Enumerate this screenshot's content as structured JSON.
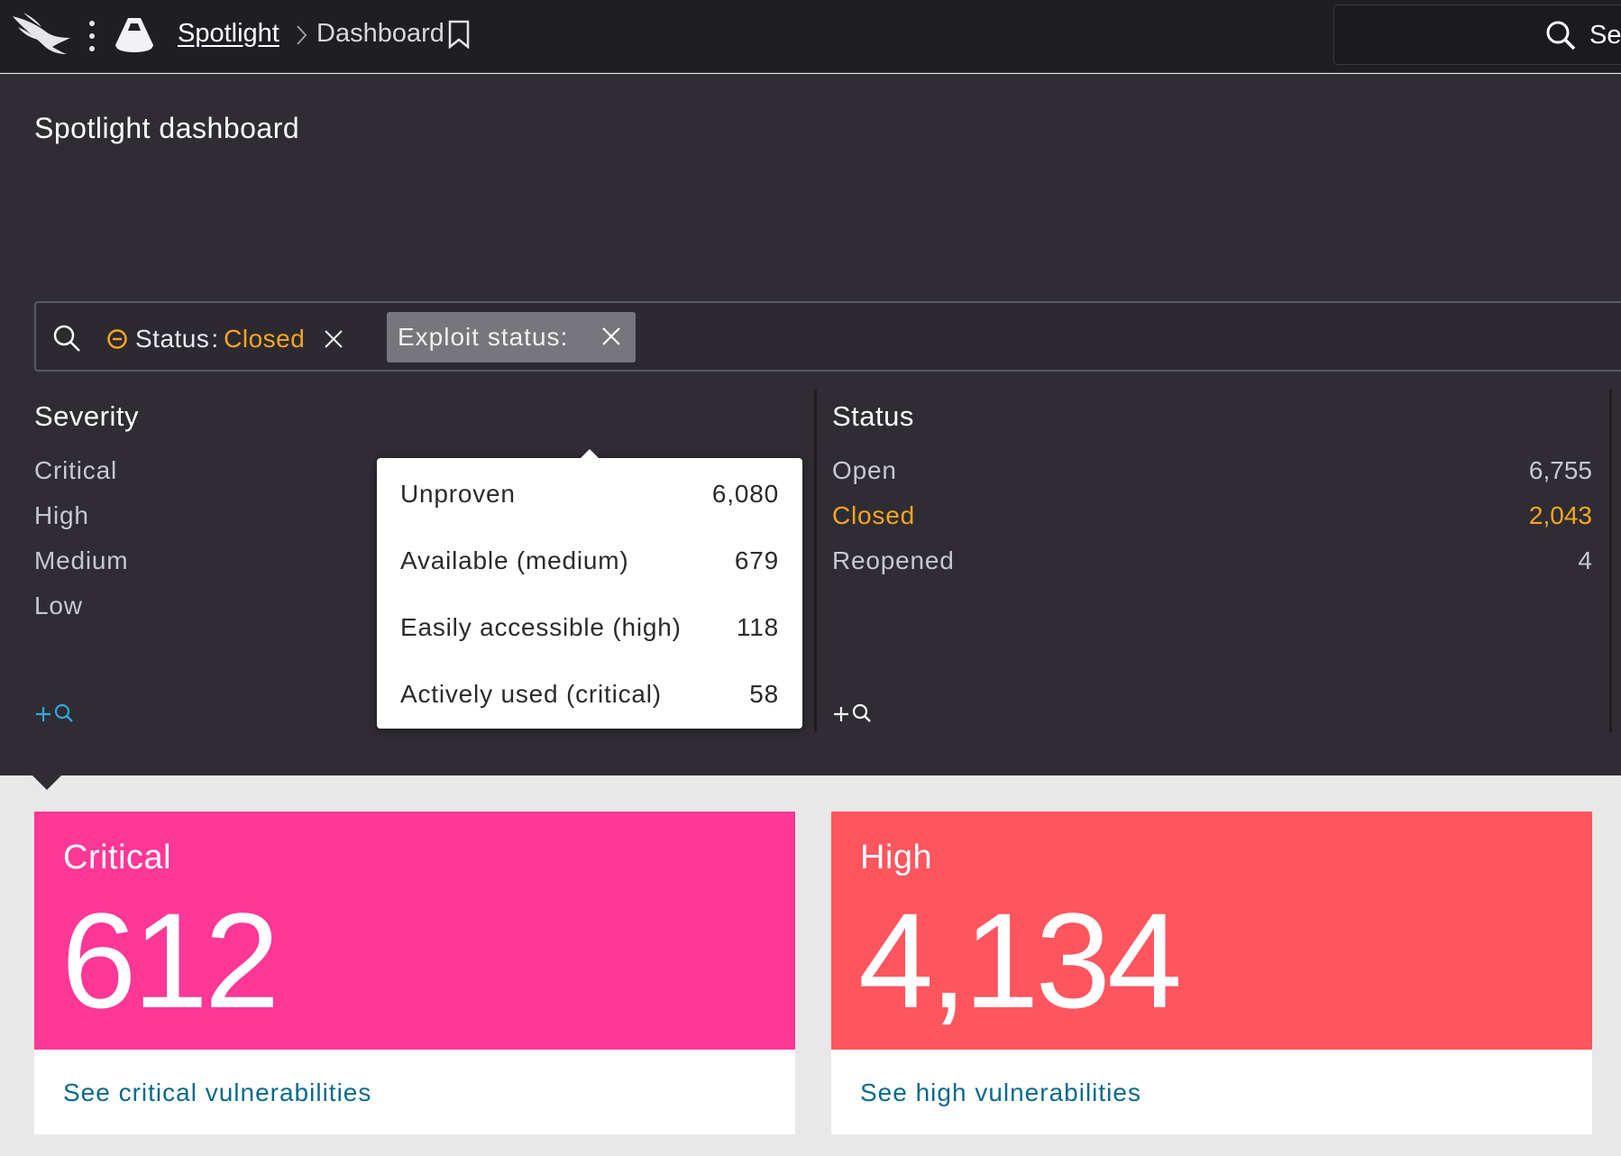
{
  "topbar": {
    "breadcrumb_link": "Spotlight",
    "breadcrumb_current": "Dashboard",
    "search_placeholder": "Sea"
  },
  "page": {
    "title": "Spotlight dashboard"
  },
  "filters": {
    "chip1_key": "Status",
    "chip1_colon": ":",
    "chip1_value": "Closed",
    "chip2_key": "Exploit status:"
  },
  "severity": {
    "title": "Severity",
    "items": [
      "Critical",
      "High",
      "Medium",
      "Low"
    ]
  },
  "exploit_popover": {
    "rows": [
      {
        "label": "Unproven",
        "count": "6,080"
      },
      {
        "label": "Available (medium)",
        "count": "679"
      },
      {
        "label": "Easily accessible (high)",
        "count": "118"
      },
      {
        "label": "Actively used (critical)",
        "count": "58"
      }
    ]
  },
  "status": {
    "title": "Status",
    "items": [
      {
        "label": "Open",
        "count": "6,755"
      },
      {
        "label": "Closed",
        "count": "2,043",
        "highlighted": true
      },
      {
        "label": "Reopened",
        "count": "4"
      }
    ]
  },
  "cards": [
    {
      "title": "Critical",
      "count": "612",
      "link": "See critical vulnerabilities",
      "color": "#ff3797"
    },
    {
      "title": "High",
      "count": "4,134",
      "link": "See high vulnerabilities",
      "color": "#ff555e"
    }
  ],
  "colors": {
    "accent_orange": "#f5a623",
    "add_search_blue": "#2ea8e0"
  }
}
